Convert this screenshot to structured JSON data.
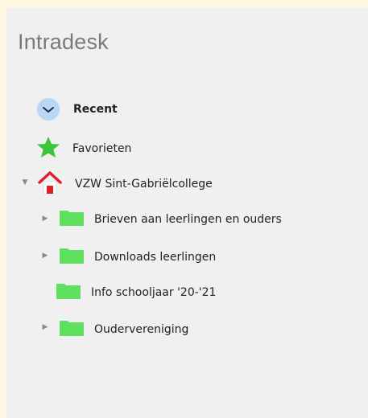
{
  "app": {
    "title": "Intradesk"
  },
  "nav": {
    "recent": {
      "label": "Recent",
      "icon": "clock-icon"
    },
    "favorites": {
      "label": "Favorieten",
      "icon": "star-icon"
    },
    "org": {
      "label": "VZW Sint-Gabriëlcollege",
      "icon": "home-icon",
      "expanded": true
    },
    "folders": [
      {
        "label": "Brieven aan leerlingen en ouders",
        "icon": "folder-icon",
        "expandable": true
      },
      {
        "label": "Downloads leerlingen",
        "icon": "folder-icon",
        "expandable": true
      },
      {
        "label": "Info schooljaar '20-'21",
        "icon": "folder-icon",
        "expandable": false
      },
      {
        "label": "Oudervereniging",
        "icon": "folder-icon",
        "expandable": true
      }
    ]
  },
  "colors": {
    "background": "#fdf6e3",
    "panel": "#f0f0f0",
    "folder": "#5fe05f",
    "star": "#3dc43d",
    "home_roof": "#e01f2a"
  }
}
